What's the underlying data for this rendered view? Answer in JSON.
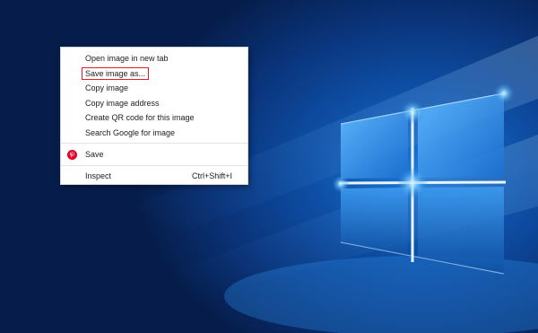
{
  "context_menu": {
    "items": [
      {
        "label": "Open image in new tab"
      },
      {
        "label": "Save image as..."
      },
      {
        "label": "Copy image"
      },
      {
        "label": "Copy image address"
      },
      {
        "label": "Create QR code for this image"
      },
      {
        "label": "Search Google for image"
      }
    ],
    "extension_item": {
      "label": "Save",
      "icon": "pinterest-icon",
      "icon_color": "#e60023"
    },
    "inspect": {
      "label": "Inspect",
      "shortcut": "Ctrl+Shift+I"
    },
    "highlight_color": "#e21f26"
  },
  "wallpaper": {
    "name": "windows-10-hero",
    "colors": {
      "bright": "#9fdcff",
      "mid": "#1e78d6",
      "dark": "#061d4b"
    }
  }
}
